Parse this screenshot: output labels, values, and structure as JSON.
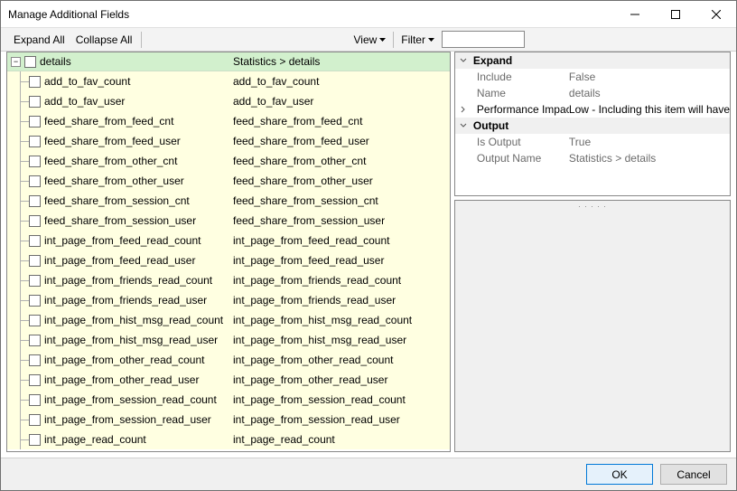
{
  "title": "Manage Additional Fields",
  "toolbar": {
    "expand_all": "Expand All",
    "collapse_all": "Collapse All",
    "view": "View",
    "filter": "Filter",
    "filter_value": ""
  },
  "tree": {
    "header_name": "details",
    "header_stat": "Statistics > details",
    "rows": [
      {
        "name": "add_to_fav_count",
        "stat": "add_to_fav_count"
      },
      {
        "name": "add_to_fav_user",
        "stat": "add_to_fav_user"
      },
      {
        "name": "feed_share_from_feed_cnt",
        "stat": "feed_share_from_feed_cnt"
      },
      {
        "name": "feed_share_from_feed_user",
        "stat": "feed_share_from_feed_user"
      },
      {
        "name": "feed_share_from_other_cnt",
        "stat": "feed_share_from_other_cnt"
      },
      {
        "name": "feed_share_from_other_user",
        "stat": "feed_share_from_other_user"
      },
      {
        "name": "feed_share_from_session_cnt",
        "stat": "feed_share_from_session_cnt"
      },
      {
        "name": "feed_share_from_session_user",
        "stat": "feed_share_from_session_user"
      },
      {
        "name": "int_page_from_feed_read_count",
        "stat": "int_page_from_feed_read_count"
      },
      {
        "name": "int_page_from_feed_read_user",
        "stat": "int_page_from_feed_read_user"
      },
      {
        "name": "int_page_from_friends_read_count",
        "stat": "int_page_from_friends_read_count"
      },
      {
        "name": "int_page_from_friends_read_user",
        "stat": "int_page_from_friends_read_user"
      },
      {
        "name": "int_page_from_hist_msg_read_count",
        "stat": "int_page_from_hist_msg_read_count"
      },
      {
        "name": "int_page_from_hist_msg_read_user",
        "stat": "int_page_from_hist_msg_read_user"
      },
      {
        "name": "int_page_from_other_read_count",
        "stat": "int_page_from_other_read_count"
      },
      {
        "name": "int_page_from_other_read_user",
        "stat": "int_page_from_other_read_user"
      },
      {
        "name": "int_page_from_session_read_count",
        "stat": "int_page_from_session_read_count"
      },
      {
        "name": "int_page_from_session_read_user",
        "stat": "int_page_from_session_read_user"
      },
      {
        "name": "int_page_read_count",
        "stat": "int_page_read_count"
      }
    ]
  },
  "props": {
    "expand_group": "Expand",
    "include_label": "Include",
    "include_value": "False",
    "name_label": "Name",
    "name_value": "details",
    "perf_label": "Performance Impact",
    "perf_value": "Low - Including this item will have",
    "output_group": "Output",
    "isout_label": "Is Output",
    "isout_value": "True",
    "outname_label": "Output Name",
    "outname_value": "Statistics > details"
  },
  "footer": {
    "ok": "OK",
    "cancel": "Cancel"
  }
}
